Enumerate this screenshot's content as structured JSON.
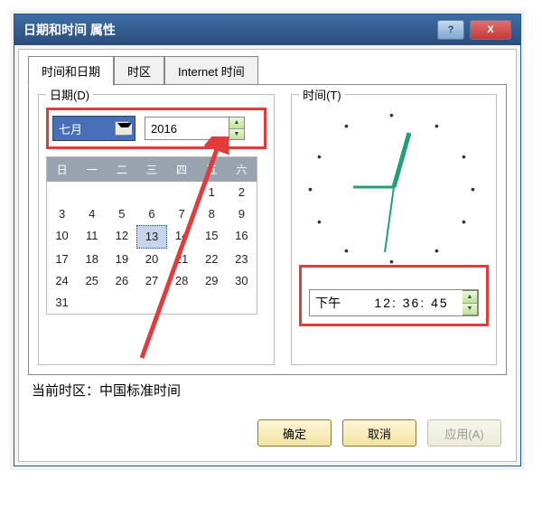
{
  "window": {
    "title": "日期和时间 属性"
  },
  "tabs": {
    "tab1": "时间和日期",
    "tab2": "时区",
    "tab3": "Internet 时间"
  },
  "date": {
    "group_label": "日期(D)",
    "month_selected": "七月",
    "year": "2016",
    "weekdays": [
      "日",
      "一",
      "二",
      "三",
      "四",
      "五",
      "六"
    ],
    "grid": [
      [
        "",
        "",
        "",
        "",
        "",
        "1",
        "2"
      ],
      [
        "3",
        "4",
        "5",
        "6",
        "7",
        "8",
        "9"
      ],
      [
        "10",
        "11",
        "12",
        "13",
        "14",
        "15",
        "16"
      ],
      [
        "17",
        "18",
        "19",
        "20",
        "21",
        "22",
        "23"
      ],
      [
        "24",
        "25",
        "26",
        "27",
        "28",
        "29",
        "30"
      ],
      [
        "31",
        "",
        "",
        "",
        "",
        "",
        ""
      ]
    ],
    "selected_day": "13"
  },
  "time": {
    "group_label": "时间(T)",
    "ampm": "下午",
    "digits": "12: 36: 45"
  },
  "tz": {
    "label": "当前时区：",
    "value": "中国标准时间"
  },
  "buttons": {
    "ok": "确定",
    "cancel": "取消",
    "apply": "应用(A)"
  }
}
